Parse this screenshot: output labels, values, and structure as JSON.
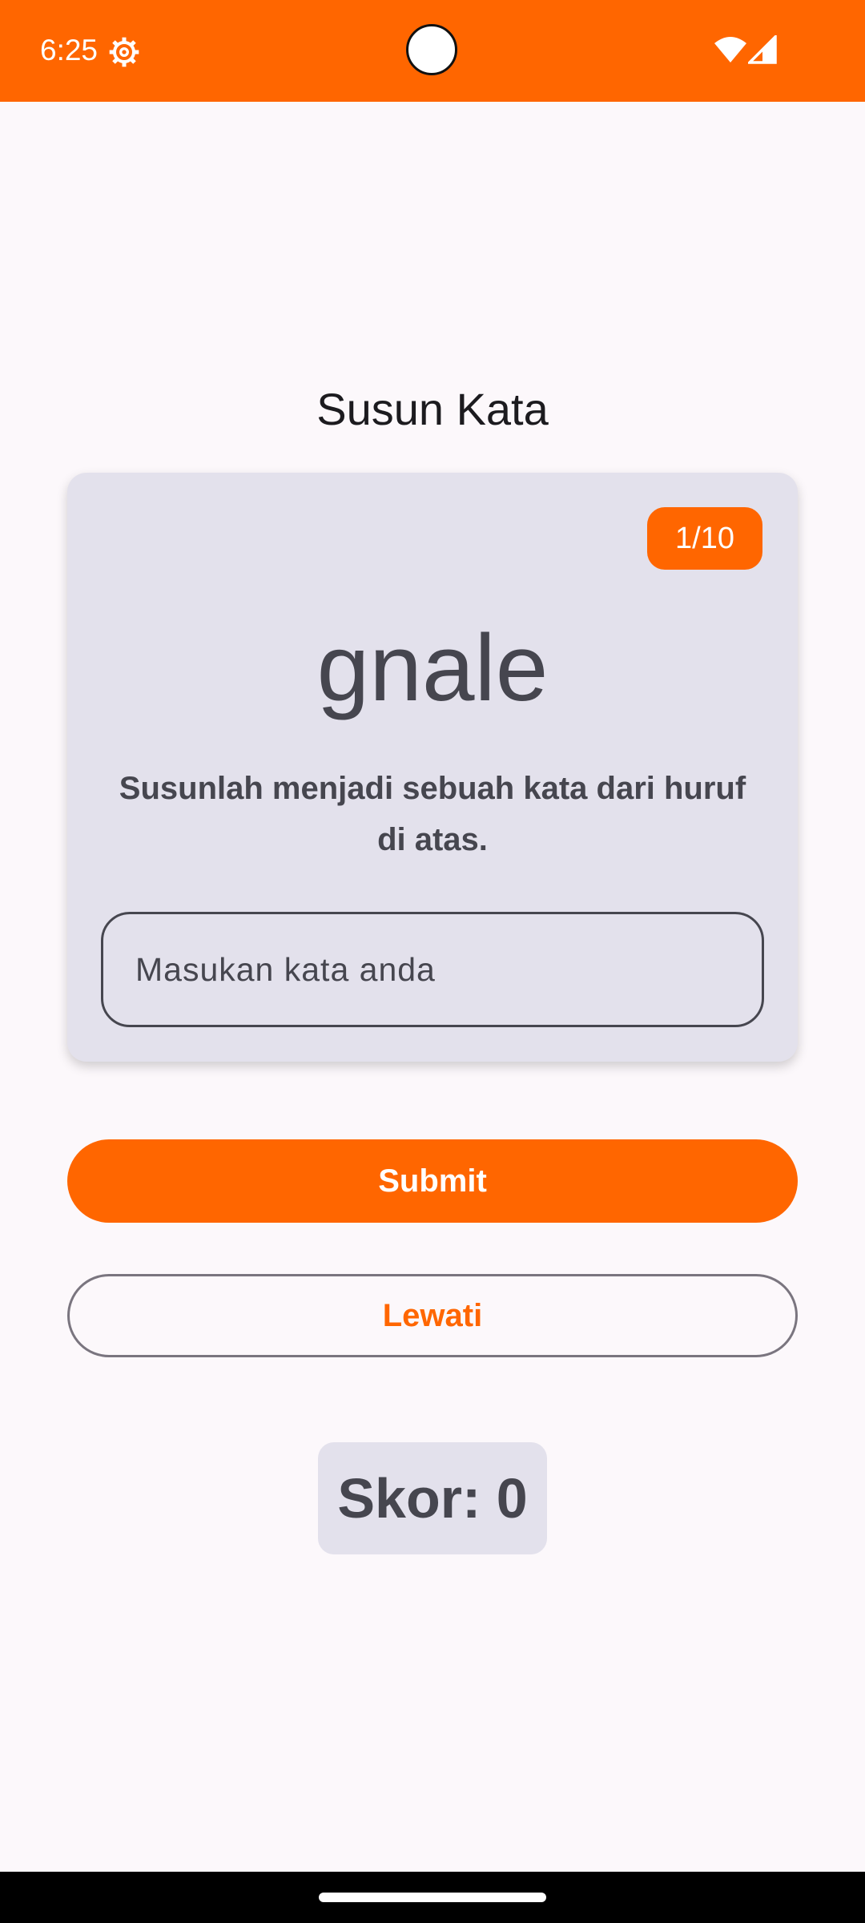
{
  "status_bar": {
    "time": "6:25",
    "background_color": "#ff6600",
    "icons": [
      "settings-gear-icon",
      "wifi-icon",
      "cellular-signal-icon"
    ]
  },
  "title": "Susun Kata",
  "card": {
    "progress": "1/10",
    "scrambled_word": "gnale",
    "instruction": "Susunlah menjadi sebuah kata dari huruf di atas.",
    "input": {
      "value": "",
      "placeholder": "Masukan kata anda"
    }
  },
  "buttons": {
    "submit_label": "Submit",
    "skip_label": "Lewati"
  },
  "score": {
    "label": "Skor: 0"
  },
  "colors": {
    "accent": "#ff6600",
    "card_background": "#e3e1ec",
    "text": "#46464f",
    "page_background": "#fcf8fb"
  }
}
